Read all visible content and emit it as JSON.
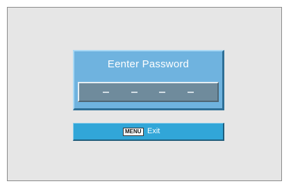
{
  "dialog": {
    "title": "Eenter Password",
    "password_mask": [
      "_",
      "_",
      "_",
      "_"
    ]
  },
  "menu_bar": {
    "key_label": "MENU",
    "action_label": "Exit"
  },
  "colors": {
    "screen_bg": "#e6e6e6",
    "dialog_bg": "#6fb3df",
    "field_bg": "#6f8b9c",
    "menu_bar_bg": "#31a6d8"
  }
}
